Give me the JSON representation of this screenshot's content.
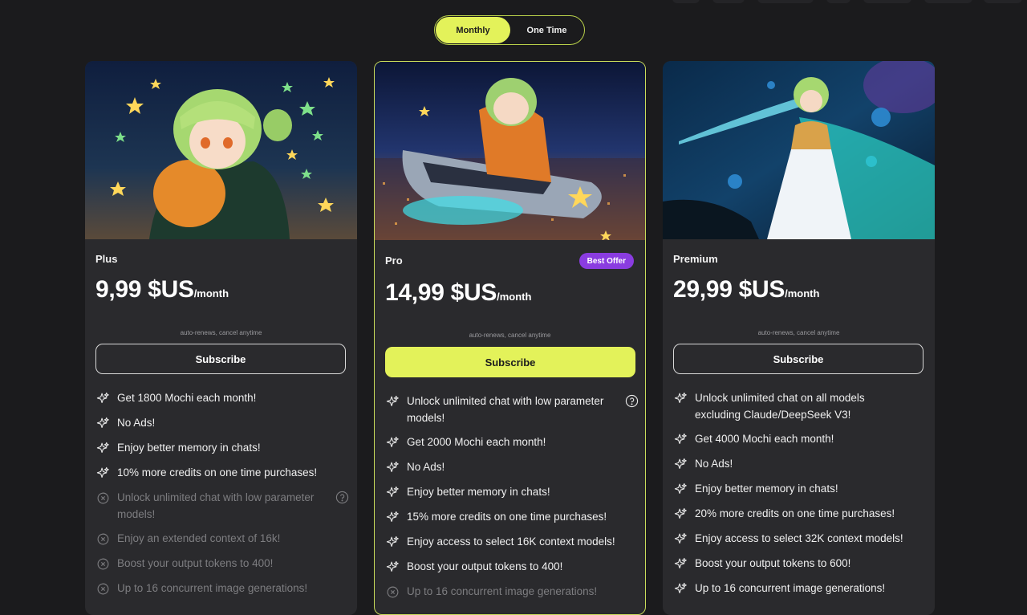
{
  "billing_toggle": {
    "monthly": "Monthly",
    "one_time": "One Time",
    "selected": "Monthly"
  },
  "plans": [
    {
      "name": "Plus",
      "price": "9,99 $US",
      "period": "/month",
      "renew_note": "auto-renews, cancel anytime",
      "cta": "Subscribe",
      "features": [
        "Get 1800 Mochi each month!",
        "No Ads!",
        "Enjoy better memory in chats!",
        "10% more credits on one time purchases!",
        "Unlock unlimited chat with low parameter models!",
        "Enjoy an extended context of 16k!",
        "Boost your output tokens to 400!",
        "Up to 16 concurrent image generations!"
      ]
    },
    {
      "name": "Pro",
      "badge": "Best Offer",
      "price": "14,99 $US",
      "period": "/month",
      "renew_note": "auto-renews, cancel anytime",
      "cta": "Subscribe",
      "features": [
        "Unlock unlimited chat with low parameter models!",
        "Get 2000 Mochi each month!",
        "No Ads!",
        "Enjoy better memory in chats!",
        "15% more credits on one time purchases!",
        "Enjoy access to select 16K context models!",
        "Boost your output tokens to 400!",
        "Up to 16 concurrent image generations!"
      ]
    },
    {
      "name": "Premium",
      "price": "29,99 $US",
      "period": "/month",
      "renew_note": "auto-renews, cancel anytime",
      "cta": "Subscribe",
      "features": [
        "Unlock unlimited chat on all models excluding Claude/DeepSeek V3!",
        "Get 4000 Mochi each month!",
        "No Ads!",
        "Enjoy better memory in chats!",
        "20% more credits on one time purchases!",
        "Enjoy access to select 32K context models!",
        "Boost your output tokens to 600!",
        "Up to 16 concurrent image generations!"
      ]
    }
  ],
  "colors": {
    "accent": "#e3f25a",
    "badge": "#8a3ce0",
    "card": "#2a2a2d",
    "background": "#1b1b1d"
  }
}
